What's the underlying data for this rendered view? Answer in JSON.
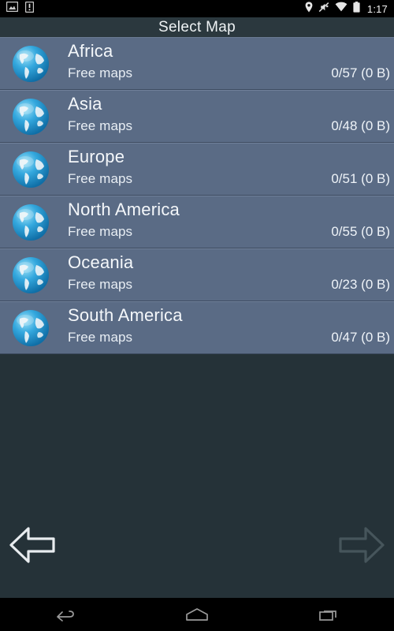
{
  "status_bar": {
    "left_icons": [
      {
        "name": "screenshot-icon",
        "label": "screenshot"
      },
      {
        "name": "sim-warning-icon",
        "label": "sim-card-warning"
      }
    ],
    "right_icons": [
      {
        "name": "location-pin-icon",
        "label": "location"
      },
      {
        "name": "ringer-muted-icon",
        "label": "ringer-off"
      },
      {
        "name": "wifi-icon",
        "label": "wifi"
      },
      {
        "name": "battery-icon",
        "label": "battery-full"
      }
    ],
    "time": "1:17"
  },
  "title_bar": {
    "title": "Select Map"
  },
  "list": {
    "item_icon": "globe-icon",
    "items": [
      {
        "name": "Africa",
        "subtitle": "Free maps",
        "count": "0/57 (0 B)"
      },
      {
        "name": "Asia",
        "subtitle": "Free maps",
        "count": "0/48 (0 B)"
      },
      {
        "name": "Europe",
        "subtitle": "Free maps",
        "count": "0/51 (0 B)"
      },
      {
        "name": "North America",
        "subtitle": "Free maps",
        "count": "0/55 (0 B)"
      },
      {
        "name": "Oceania",
        "subtitle": "Free maps",
        "count": "0/23 (0 B)"
      },
      {
        "name": "South America",
        "subtitle": "Free maps",
        "count": "0/47 (0 B)"
      }
    ]
  },
  "navigation": {
    "back_arrow": {
      "name": "previous-arrow",
      "label": "Previous",
      "state": "enabled"
    },
    "forward_arrow": {
      "name": "next-arrow",
      "label": "Next",
      "state": "disabled"
    }
  },
  "system_bar": {
    "buttons": [
      {
        "name": "android-back-button",
        "label": "Back"
      },
      {
        "name": "android-home-button",
        "label": "Home"
      },
      {
        "name": "android-recents-button",
        "label": "Recent apps"
      }
    ]
  },
  "colors": {
    "status_bar_bg": "#000000",
    "title_bar_bg": "#2b383e",
    "page_bg": "#253238",
    "row_bg": "#5a6b85",
    "row_divider": "#3e4c61",
    "text_primary": "#f4f7fa",
    "arrow_enabled": "#e8ecef",
    "arrow_disabled": "#46555b",
    "globe_blue": "#1f9ed8"
  }
}
